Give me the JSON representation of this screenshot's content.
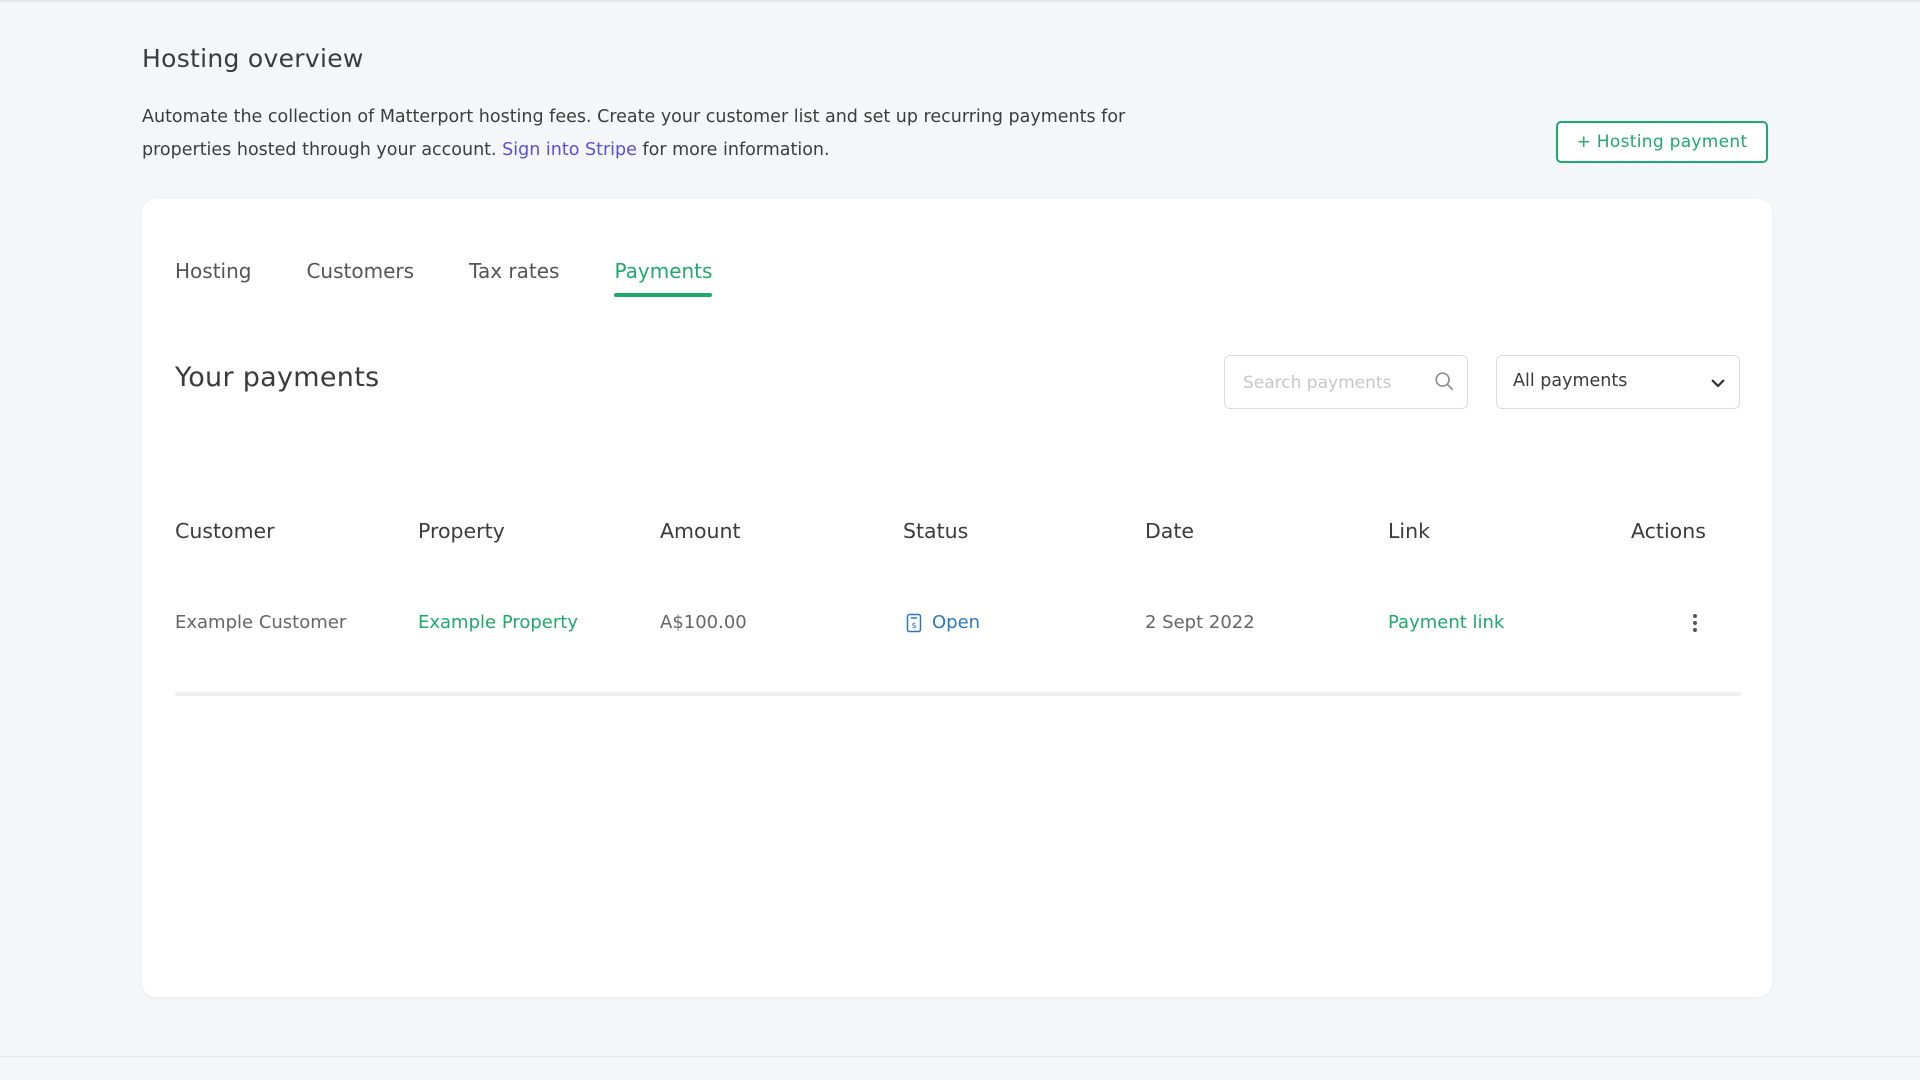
{
  "header": {
    "title": "Hosting overview",
    "intro_before": "Automate the collection of Matterport hosting fees. Create your customer list and set up recurring payments for properties hosted through your account. ",
    "intro_link": "Sign into Stripe",
    "intro_after": " for more information.",
    "primary_button": "+ Hosting payment"
  },
  "tabs": [
    {
      "label": "Hosting",
      "active": false
    },
    {
      "label": "Customers",
      "active": false
    },
    {
      "label": "Tax rates",
      "active": false
    },
    {
      "label": "Payments",
      "active": true
    }
  ],
  "payments": {
    "title": "Your payments",
    "search_placeholder": "Search payments",
    "filter_value": "All payments",
    "columns": [
      "Customer",
      "Property",
      "Amount",
      "Status",
      "Date",
      "Link",
      "Actions"
    ],
    "rows": [
      {
        "customer": "Example Customer",
        "property": "Example Property",
        "amount": "A$100.00",
        "status": "Open",
        "date": "2 Sept 2022",
        "link": "Payment link"
      }
    ]
  },
  "icons": {
    "search": "search-icon",
    "dropdown": "chevron-down-icon",
    "status": "invoice-icon",
    "actions": "more-vertical-icon"
  },
  "colors": {
    "accent": "#1eaa6b",
    "link": "#5b4fd6",
    "status_open": "#2a78c2",
    "background": "#f4f7f9"
  }
}
